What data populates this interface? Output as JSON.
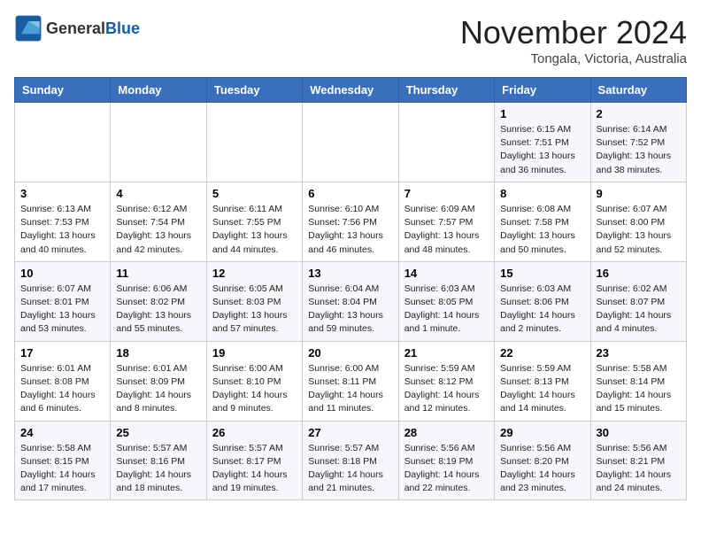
{
  "header": {
    "logo_general": "General",
    "logo_blue": "Blue",
    "month_title": "November 2024",
    "location": "Tongala, Victoria, Australia"
  },
  "weekdays": [
    "Sunday",
    "Monday",
    "Tuesday",
    "Wednesday",
    "Thursday",
    "Friday",
    "Saturday"
  ],
  "weeks": [
    [
      {
        "day": "",
        "info": ""
      },
      {
        "day": "",
        "info": ""
      },
      {
        "day": "",
        "info": ""
      },
      {
        "day": "",
        "info": ""
      },
      {
        "day": "",
        "info": ""
      },
      {
        "day": "1",
        "info": "Sunrise: 6:15 AM\nSunset: 7:51 PM\nDaylight: 13 hours\nand 36 minutes."
      },
      {
        "day": "2",
        "info": "Sunrise: 6:14 AM\nSunset: 7:52 PM\nDaylight: 13 hours\nand 38 minutes."
      }
    ],
    [
      {
        "day": "3",
        "info": "Sunrise: 6:13 AM\nSunset: 7:53 PM\nDaylight: 13 hours\nand 40 minutes."
      },
      {
        "day": "4",
        "info": "Sunrise: 6:12 AM\nSunset: 7:54 PM\nDaylight: 13 hours\nand 42 minutes."
      },
      {
        "day": "5",
        "info": "Sunrise: 6:11 AM\nSunset: 7:55 PM\nDaylight: 13 hours\nand 44 minutes."
      },
      {
        "day": "6",
        "info": "Sunrise: 6:10 AM\nSunset: 7:56 PM\nDaylight: 13 hours\nand 46 minutes."
      },
      {
        "day": "7",
        "info": "Sunrise: 6:09 AM\nSunset: 7:57 PM\nDaylight: 13 hours\nand 48 minutes."
      },
      {
        "day": "8",
        "info": "Sunrise: 6:08 AM\nSunset: 7:58 PM\nDaylight: 13 hours\nand 50 minutes."
      },
      {
        "day": "9",
        "info": "Sunrise: 6:07 AM\nSunset: 8:00 PM\nDaylight: 13 hours\nand 52 minutes."
      }
    ],
    [
      {
        "day": "10",
        "info": "Sunrise: 6:07 AM\nSunset: 8:01 PM\nDaylight: 13 hours\nand 53 minutes."
      },
      {
        "day": "11",
        "info": "Sunrise: 6:06 AM\nSunset: 8:02 PM\nDaylight: 13 hours\nand 55 minutes."
      },
      {
        "day": "12",
        "info": "Sunrise: 6:05 AM\nSunset: 8:03 PM\nDaylight: 13 hours\nand 57 minutes."
      },
      {
        "day": "13",
        "info": "Sunrise: 6:04 AM\nSunset: 8:04 PM\nDaylight: 13 hours\nand 59 minutes."
      },
      {
        "day": "14",
        "info": "Sunrise: 6:03 AM\nSunset: 8:05 PM\nDaylight: 14 hours\nand 1 minute."
      },
      {
        "day": "15",
        "info": "Sunrise: 6:03 AM\nSunset: 8:06 PM\nDaylight: 14 hours\nand 2 minutes."
      },
      {
        "day": "16",
        "info": "Sunrise: 6:02 AM\nSunset: 8:07 PM\nDaylight: 14 hours\nand 4 minutes."
      }
    ],
    [
      {
        "day": "17",
        "info": "Sunrise: 6:01 AM\nSunset: 8:08 PM\nDaylight: 14 hours\nand 6 minutes."
      },
      {
        "day": "18",
        "info": "Sunrise: 6:01 AM\nSunset: 8:09 PM\nDaylight: 14 hours\nand 8 minutes."
      },
      {
        "day": "19",
        "info": "Sunrise: 6:00 AM\nSunset: 8:10 PM\nDaylight: 14 hours\nand 9 minutes."
      },
      {
        "day": "20",
        "info": "Sunrise: 6:00 AM\nSunset: 8:11 PM\nDaylight: 14 hours\nand 11 minutes."
      },
      {
        "day": "21",
        "info": "Sunrise: 5:59 AM\nSunset: 8:12 PM\nDaylight: 14 hours\nand 12 minutes."
      },
      {
        "day": "22",
        "info": "Sunrise: 5:59 AM\nSunset: 8:13 PM\nDaylight: 14 hours\nand 14 minutes."
      },
      {
        "day": "23",
        "info": "Sunrise: 5:58 AM\nSunset: 8:14 PM\nDaylight: 14 hours\nand 15 minutes."
      }
    ],
    [
      {
        "day": "24",
        "info": "Sunrise: 5:58 AM\nSunset: 8:15 PM\nDaylight: 14 hours\nand 17 minutes."
      },
      {
        "day": "25",
        "info": "Sunrise: 5:57 AM\nSunset: 8:16 PM\nDaylight: 14 hours\nand 18 minutes."
      },
      {
        "day": "26",
        "info": "Sunrise: 5:57 AM\nSunset: 8:17 PM\nDaylight: 14 hours\nand 19 minutes."
      },
      {
        "day": "27",
        "info": "Sunrise: 5:57 AM\nSunset: 8:18 PM\nDaylight: 14 hours\nand 21 minutes."
      },
      {
        "day": "28",
        "info": "Sunrise: 5:56 AM\nSunset: 8:19 PM\nDaylight: 14 hours\nand 22 minutes."
      },
      {
        "day": "29",
        "info": "Sunrise: 5:56 AM\nSunset: 8:20 PM\nDaylight: 14 hours\nand 23 minutes."
      },
      {
        "day": "30",
        "info": "Sunrise: 5:56 AM\nSunset: 8:21 PM\nDaylight: 14 hours\nand 24 minutes."
      }
    ]
  ]
}
